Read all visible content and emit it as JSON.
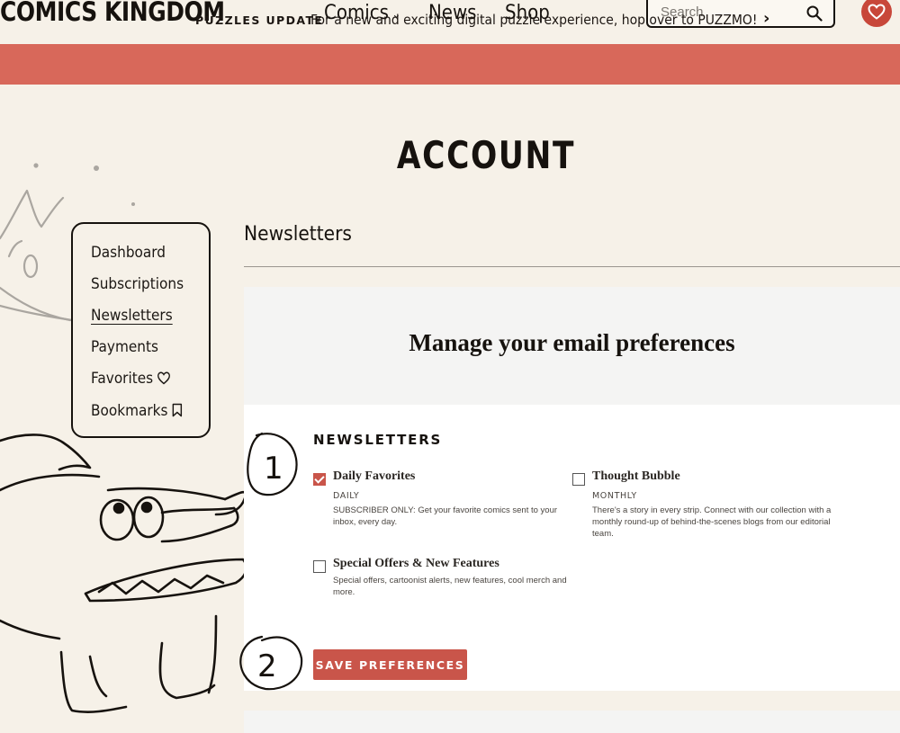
{
  "header": {
    "logo": "COMICS KINGDOM",
    "nav": [
      {
        "label": "Comics",
        "has_dropdown": true
      },
      {
        "label": "News"
      },
      {
        "label": "Shop"
      }
    ],
    "search": {
      "placeholder": "Search",
      "value": ""
    },
    "icons": {
      "search": "search-icon",
      "favorites": "heart-icon"
    }
  },
  "banner": {
    "label": "PUZZLES UPDATE",
    "text": "For a new and exciting digital puzzle experience, hop over to PUZZMO!",
    "arrow": "›",
    "color": "#d8685a"
  },
  "page": {
    "title": "ACCOUNT"
  },
  "sidebar": {
    "items": [
      {
        "label": "Dashboard"
      },
      {
        "label": "Subscriptions"
      },
      {
        "label": "Newsletters",
        "active": true
      },
      {
        "label": "Payments"
      },
      {
        "label": "Favorites",
        "icon": "heart-outline-icon"
      },
      {
        "label": "Bookmarks",
        "icon": "bookmark-icon"
      }
    ]
  },
  "section": {
    "heading": "Newsletters"
  },
  "card": {
    "title": "Manage your email preferences",
    "newsletters_heading": "NEWSLETTERS",
    "newsletters": [
      {
        "title": "Daily Favorites",
        "checked": true,
        "frequency": "DAILY",
        "description": "SUBSCRIBER ONLY: Get your favorite comics sent to your inbox, every day."
      },
      {
        "title": "Thought Bubble",
        "checked": false,
        "frequency": "MONTHLY",
        "description": "There's a story in every strip. Connect with our collection with a monthly round-up of behind-the-scenes blogs from our editorial team."
      },
      {
        "title": "Special Offers & New Features",
        "checked": false,
        "frequency": "",
        "description": "Special offers, cartoonist alerts, new features, cool merch and more."
      }
    ],
    "save_button": "SAVE PREFERENCES"
  },
  "annotations": {
    "step1": "1",
    "step2": "2"
  },
  "colors": {
    "accent": "#c9554a",
    "background": "#f6f1e8",
    "ink": "#16120e"
  }
}
